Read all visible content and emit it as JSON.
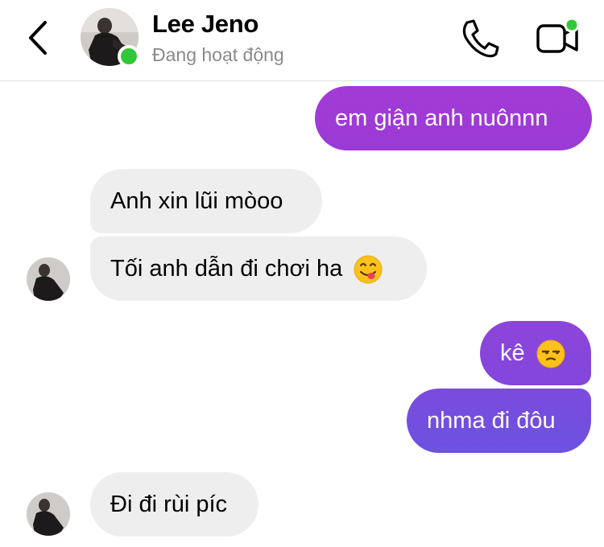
{
  "header": {
    "contact_name": "Lee Jeno",
    "status": "Đang hoạt động"
  },
  "icons": {
    "back": "chevron-left-icon",
    "call": "phone-icon",
    "video": "video-camera-icon"
  },
  "colors": {
    "online": "#31c837",
    "incoming_bubble": "#eeeeee",
    "outgoing_gradient_top": "#a33bd6",
    "outgoing_gradient_bottom": "#6a52e0"
  },
  "messages": [
    {
      "direction": "outgoing",
      "text": "em giận anh nuônnn"
    },
    {
      "direction": "incoming",
      "text": "Anh xin lũi mòoo"
    },
    {
      "direction": "incoming",
      "text": "Tối anh dẫn đi chơi ha",
      "emoji": "yum-face-emoji"
    },
    {
      "direction": "outgoing",
      "text": "kê",
      "emoji": "unamused-face-emoji"
    },
    {
      "direction": "outgoing",
      "text": "nhma đi đôu"
    },
    {
      "direction": "incoming",
      "text": "Đi đi rùi píc"
    }
  ]
}
